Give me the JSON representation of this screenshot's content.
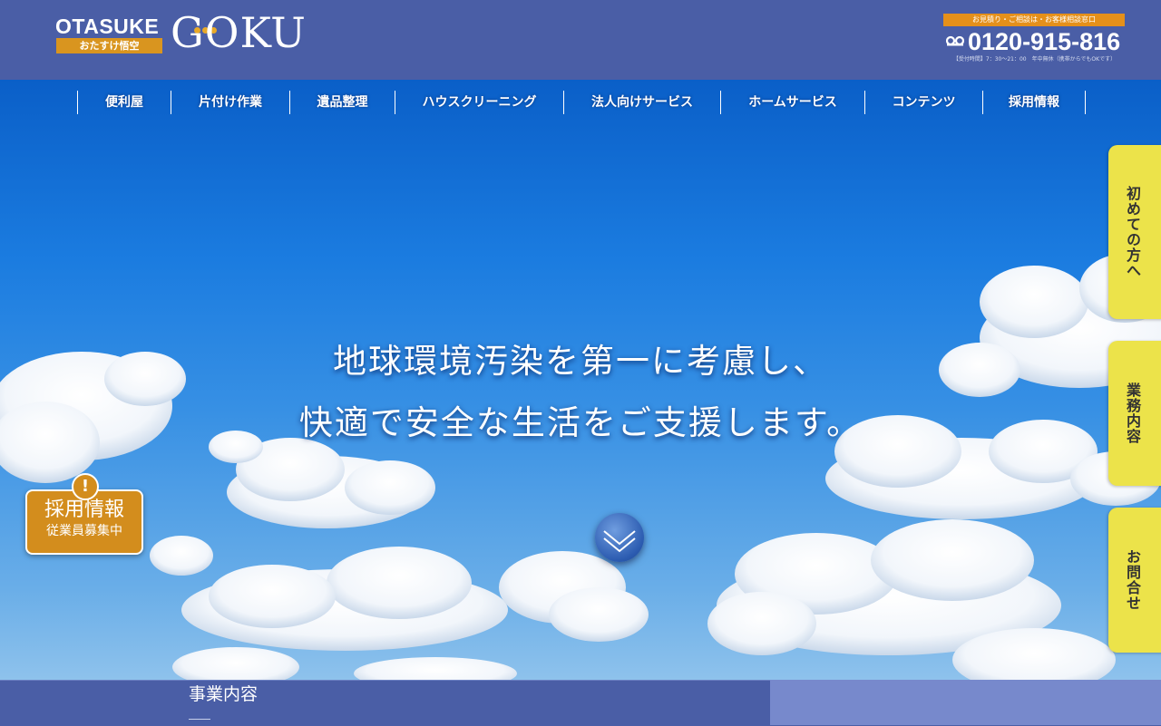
{
  "header": {
    "logo_brand": "OTASUKE",
    "logo_sub": "おたすけ悟空",
    "logo_name": "GOKU",
    "contact_label": "お見積り・ご相談は・お客様相談窓口",
    "phone": "0120-915-816",
    "hours": "【受付時間】7：30～21：00　年中無休（携帯からでもOKです）"
  },
  "nav": {
    "items": [
      {
        "label": "便利屋"
      },
      {
        "label": "片付け作業"
      },
      {
        "label": "遺品整理"
      },
      {
        "label": "ハウスクリーニング"
      },
      {
        "label": "法人向けサービス"
      },
      {
        "label": "ホームサービス"
      },
      {
        "label": "コンテンツ"
      },
      {
        "label": "採用情報"
      }
    ]
  },
  "hero": {
    "line1": "地球環境汚染を第一に考慮し、",
    "line2": "快適で安全な生活をご支援します。"
  },
  "recruit": {
    "alert": "!",
    "title": "採用情報",
    "sub": "従業員募集中"
  },
  "side_tabs": [
    {
      "label": "初めての方へ"
    },
    {
      "label": "業務内容"
    },
    {
      "label": "お問合せ"
    }
  ],
  "section": {
    "title": "事業内容"
  },
  "colors": {
    "header_bg": "#4a5ea6",
    "accent_orange": "#d9951f",
    "tab_yellow": "#ece34a",
    "sky_blue": "#1b7ce0"
  },
  "icons": {
    "phone": "free-dial-icon",
    "scroll": "chevron-down-icon"
  }
}
